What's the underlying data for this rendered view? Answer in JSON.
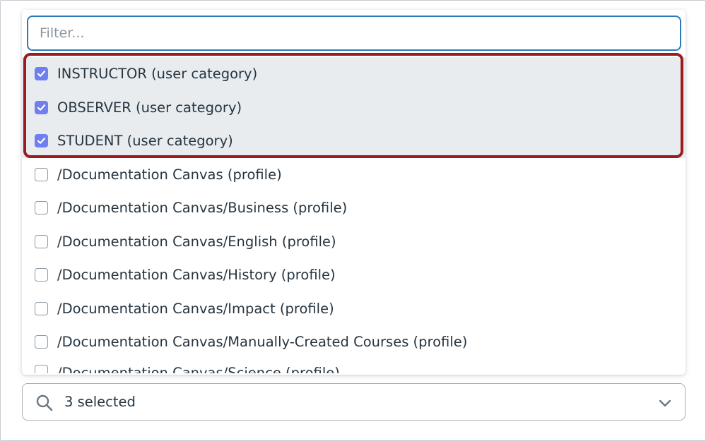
{
  "filter": {
    "placeholder": "Filter..."
  },
  "options": [
    {
      "label": "INSTRUCTOR (user category)",
      "checked": true
    },
    {
      "label": "OBSERVER (user category)",
      "checked": true
    },
    {
      "label": "STUDENT (user category)",
      "checked": true
    },
    {
      "label": "/Documentation Canvas (profile)",
      "checked": false
    },
    {
      "label": "/Documentation Canvas/Business (profile)",
      "checked": false
    },
    {
      "label": "/Documentation Canvas/English (profile)",
      "checked": false
    },
    {
      "label": "/Documentation Canvas/History (profile)",
      "checked": false
    },
    {
      "label": "/Documentation Canvas/Impact (profile)",
      "checked": false
    },
    {
      "label": "/Documentation Canvas/Manually-Created Courses (profile)",
      "checked": false
    },
    {
      "label": "/Documentation Canvas/Science (profile)",
      "checked": false
    }
  ],
  "select": {
    "summary": "3 selected"
  },
  "icons": {
    "search": "search-icon",
    "chevron": "chevron-down-icon",
    "check": "checkmark-icon"
  },
  "colors": {
    "checkbox_checked": "#6f7ff0",
    "highlight_border": "#9b1c1c",
    "input_focus_border": "#2b7abc",
    "selected_row_bg": "#e8ecef"
  }
}
